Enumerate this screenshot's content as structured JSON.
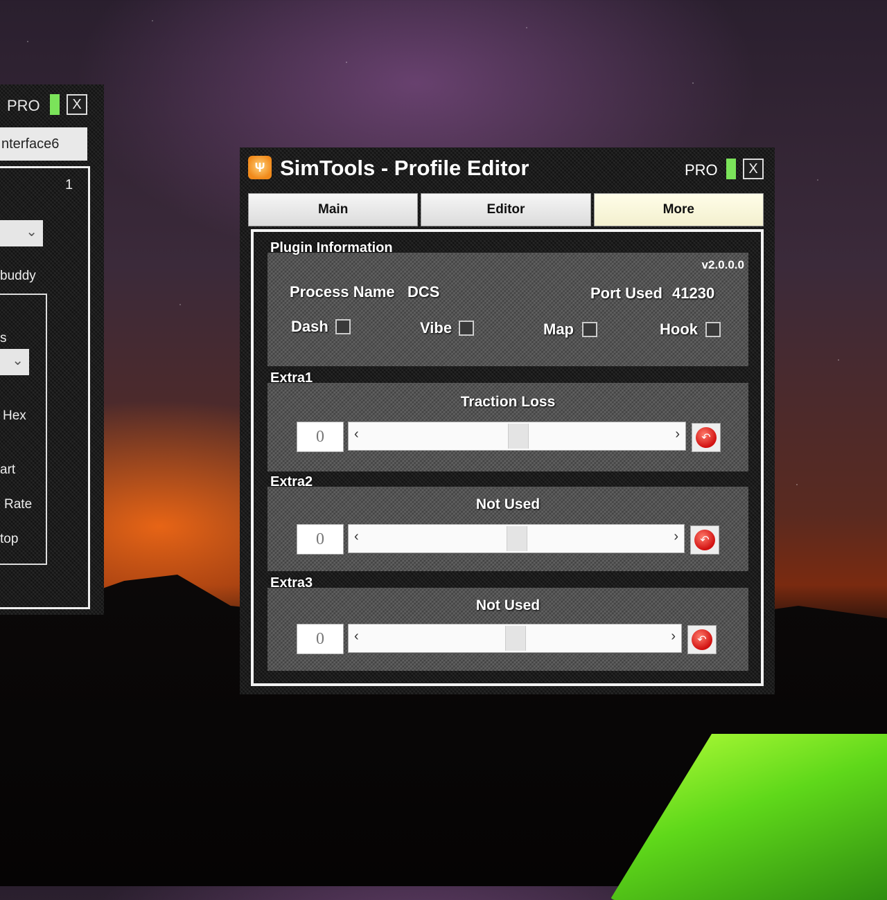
{
  "left_window": {
    "pro_label": "PRO",
    "close_label": "X",
    "interface_text": "nterface6",
    "number": "1",
    "labels": [
      "buddy",
      "s",
      "Hex",
      "art",
      "Rate",
      "top"
    ]
  },
  "window": {
    "title": "SimTools - Profile Editor",
    "pro_label": "PRO",
    "close_label": "X",
    "app_icon": "simtools-logo-icon"
  },
  "tabs": [
    {
      "label": "Main"
    },
    {
      "label": "Editor"
    },
    {
      "label": "More",
      "active": true
    }
  ],
  "plugin_info": {
    "group_label": "Plugin Information",
    "version": "v2.0.0.0",
    "process_name_label": "Process Name",
    "process_name_value": "DCS",
    "port_used_label": "Port Used",
    "port_used_value": "41230",
    "checkboxes": [
      {
        "label": "Dash",
        "checked": false
      },
      {
        "label": "Vibe",
        "checked": false
      },
      {
        "label": "Map",
        "checked": false
      },
      {
        "label": "Hook",
        "checked": false
      }
    ]
  },
  "extras": [
    {
      "group_label": "Extra1",
      "title": "Traction Loss",
      "value": "0",
      "slider_position": 0.5
    },
    {
      "group_label": "Extra2",
      "title": "Not Used",
      "value": "0",
      "slider_position": 0.5
    },
    {
      "group_label": "Extra3",
      "title": "Not Used",
      "value": "0",
      "slider_position": 0.5
    }
  ],
  "icons": {
    "scroll_left": "‹",
    "scroll_right": "›",
    "reset": "reset-icon",
    "dropdown": "chevron-down-icon"
  },
  "colors": {
    "pro_indicator": "#7be35a",
    "reset_button": "#d11010",
    "active_tab": "#f3f0cf"
  }
}
